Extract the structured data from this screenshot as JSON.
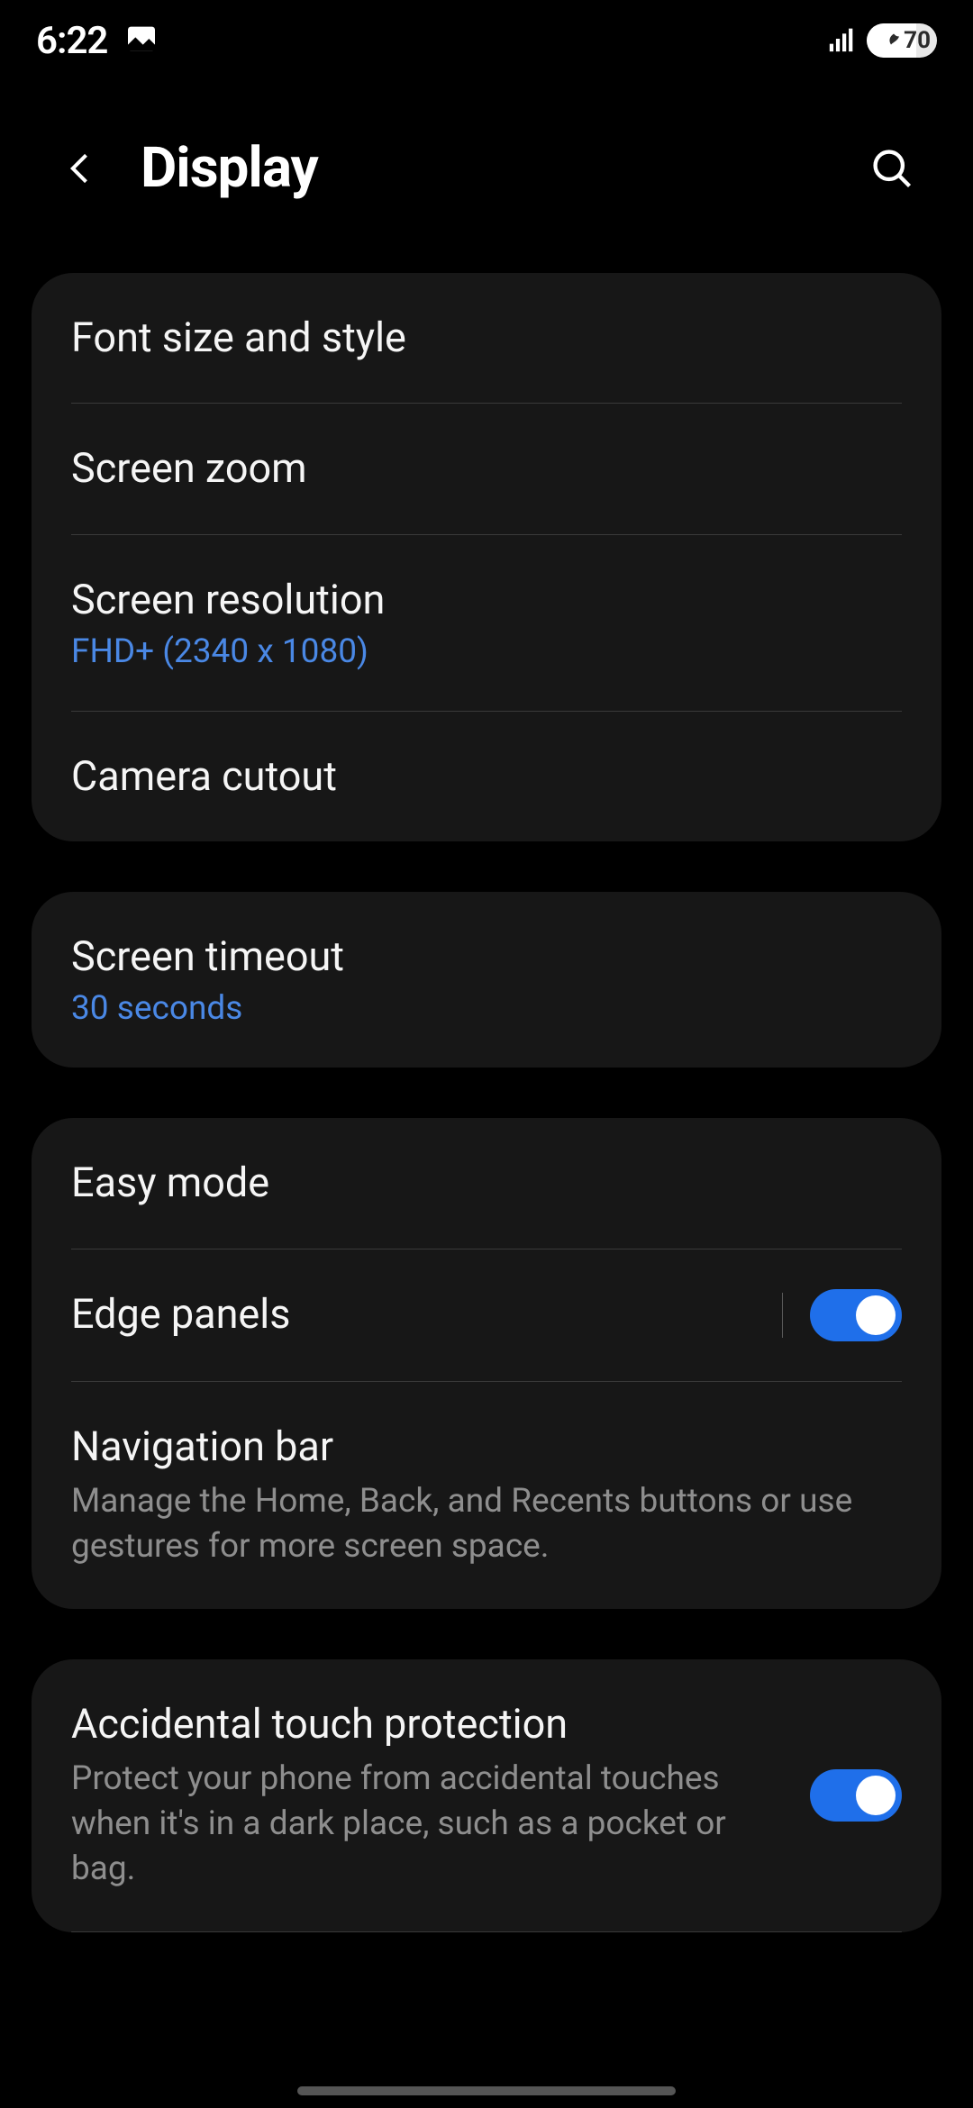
{
  "status": {
    "time": "6:22",
    "battery": "70"
  },
  "header": {
    "title": "Display"
  },
  "groups": [
    {
      "rows": [
        {
          "title": "Font size and style"
        },
        {
          "title": "Screen zoom"
        },
        {
          "title": "Screen resolution",
          "subtitle_accent": "FHD+ (2340 x 1080)"
        },
        {
          "title": "Camera cutout"
        }
      ]
    },
    {
      "rows": [
        {
          "title": "Screen timeout",
          "subtitle_accent": "30 seconds"
        }
      ]
    },
    {
      "rows": [
        {
          "title": "Easy mode"
        },
        {
          "title": "Edge panels",
          "toggle": true,
          "toggle_sep": true
        },
        {
          "title": "Navigation bar",
          "description": "Manage the Home, Back, and Recents buttons or use gestures for more screen space."
        }
      ]
    },
    {
      "rows": [
        {
          "title": "Accidental touch protection",
          "description": "Protect your phone from accidental touches when it's in a dark place, such as a pocket or bag.",
          "toggle": true
        }
      ]
    }
  ]
}
